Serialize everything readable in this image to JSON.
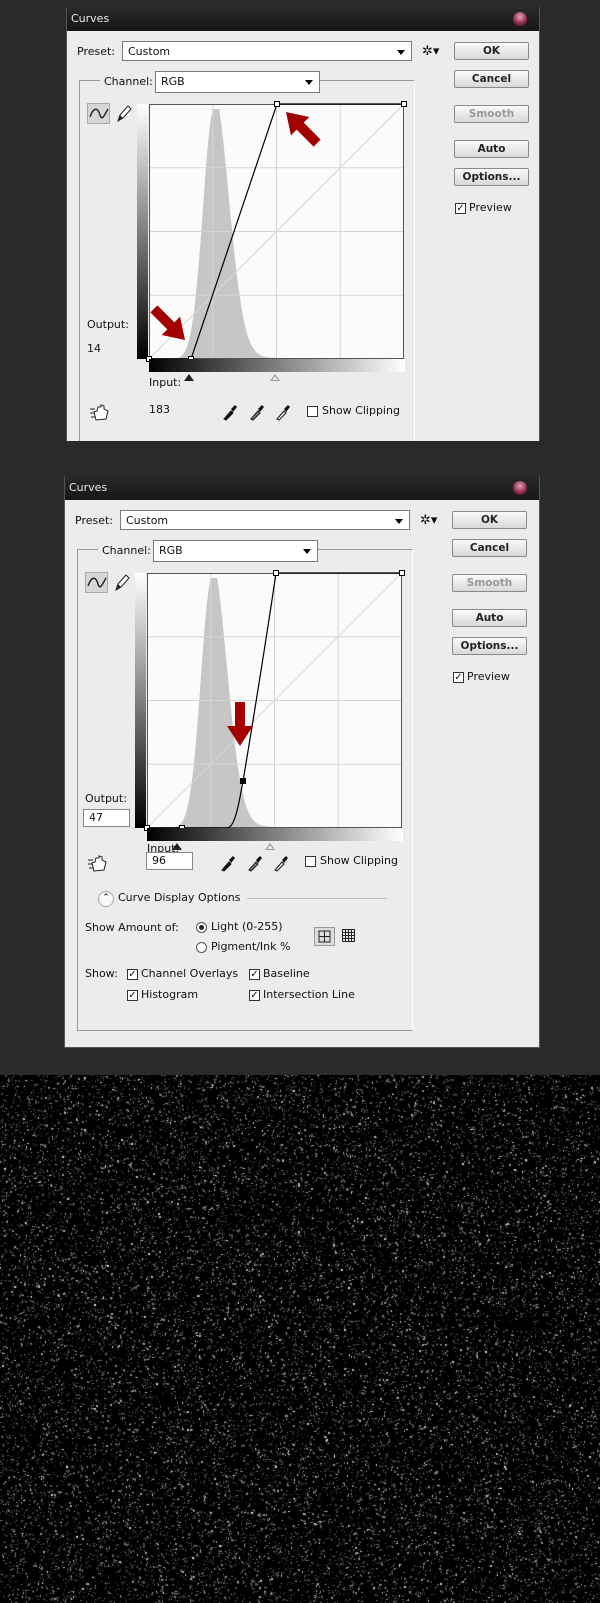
{
  "dialogs": [
    {
      "title": "Curves",
      "preset_label": "Preset:",
      "preset_value": "Custom",
      "channel_label": "Channel:",
      "channel_value": "RGB",
      "buttons": {
        "ok": "OK",
        "cancel": "Cancel",
        "smooth": "Smooth",
        "auto": "Auto",
        "options": "Options..."
      },
      "preview_label": "Preview",
      "preview_checked": true,
      "output_label": "Output:",
      "output_value": "14",
      "input_label": "Input:",
      "input_value": "183",
      "show_clipping_label": "Show Clipping",
      "show_clipping_checked": false,
      "curve_points": [
        [
          0,
          0
        ],
        [
          42,
          0
        ],
        [
          128,
          255
        ],
        [
          255,
          255
        ]
      ],
      "annotation_arrows": 2
    },
    {
      "title": "Curves",
      "preset_label": "Preset:",
      "preset_value": "Custom",
      "channel_label": "Channel:",
      "channel_value": "RGB",
      "buttons": {
        "ok": "OK",
        "cancel": "Cancel",
        "smooth": "Smooth",
        "auto": "Auto",
        "options": "Options..."
      },
      "preview_label": "Preview",
      "preview_checked": true,
      "output_label": "Output:",
      "output_value": "47",
      "input_label": "Input:",
      "input_value": "96",
      "show_clipping_label": "Show Clipping",
      "show_clipping_checked": false,
      "curve_points": [
        [
          0,
          0
        ],
        [
          35,
          0
        ],
        [
          96,
          47
        ],
        [
          129,
          255
        ],
        [
          255,
          255
        ]
      ],
      "annotation_arrows": 1,
      "display_options": {
        "header": "Curve Display Options",
        "show_amount_label": "Show Amount of:",
        "light_label": "Light  (0-255)",
        "light_selected": true,
        "pigment_label": "Pigment/Ink %",
        "show_label": "Show:",
        "channel_overlays": "Channel Overlays",
        "baseline": "Baseline",
        "histogram": "Histogram",
        "intersection_line": "Intersection Line"
      }
    }
  ],
  "colors": {
    "arrow": "#a30000",
    "background": "#2a2a2a",
    "dialog": "#ececec"
  }
}
